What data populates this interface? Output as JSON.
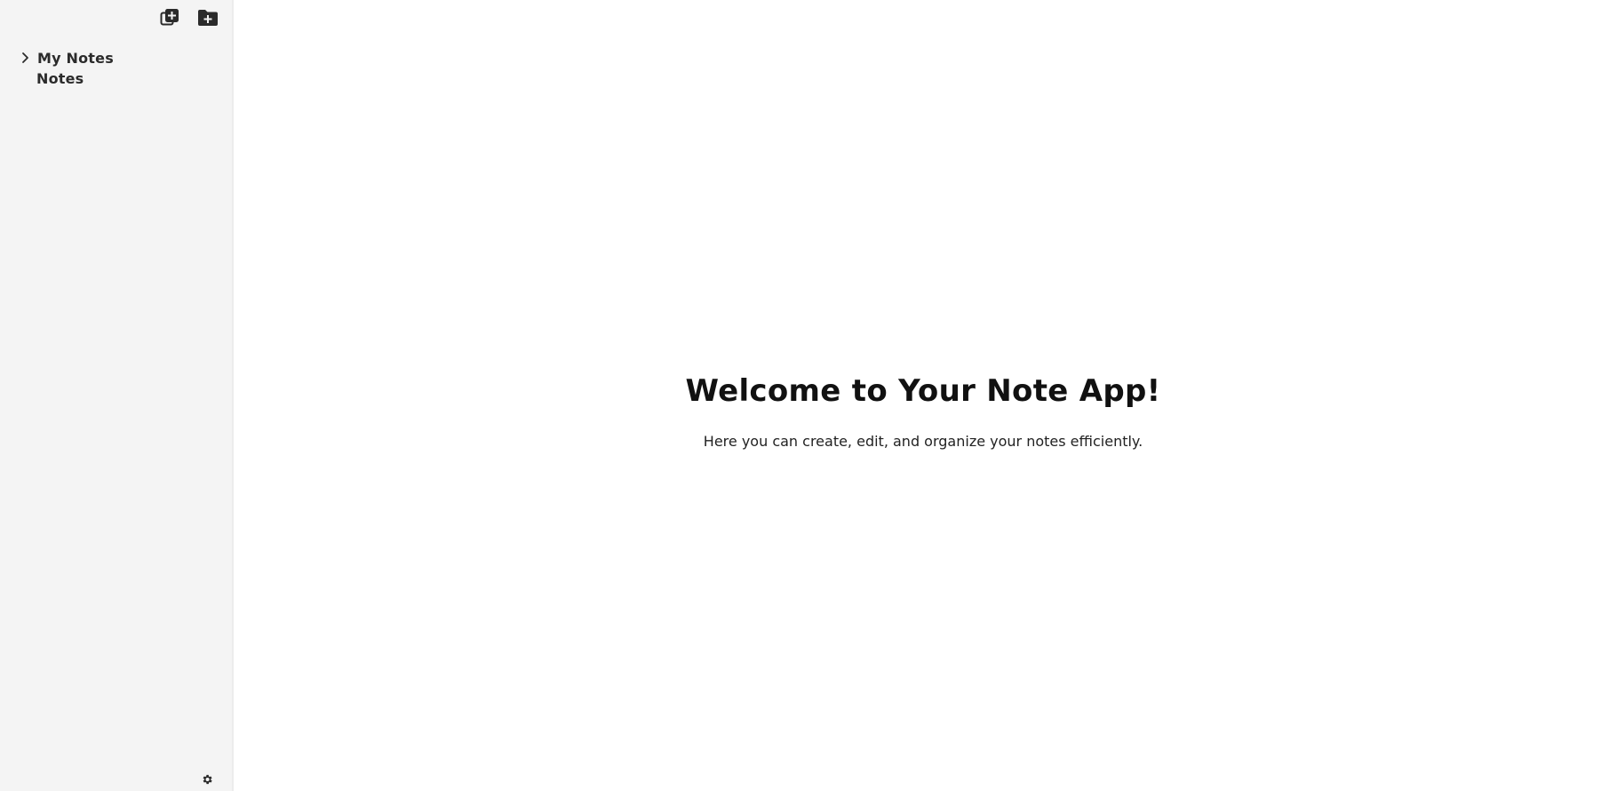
{
  "sidebar": {
    "toolbar": {
      "new_note_icon": "new-note-icon",
      "new_folder_icon": "new-folder-icon"
    },
    "tree": {
      "folders": [
        {
          "label": "My Notes",
          "expanded": false
        }
      ],
      "notes": [
        {
          "label": "Notes"
        }
      ]
    },
    "settings_icon": "gear-icon"
  },
  "main": {
    "title": "Welcome to Your Note App!",
    "subtitle": "Here you can create, edit, and organize your notes efficiently."
  },
  "colors": {
    "sidebar_bg": "#f4f4f4",
    "main_bg": "#ffffff",
    "icon": "#2b2b2b",
    "text": "#111111"
  }
}
